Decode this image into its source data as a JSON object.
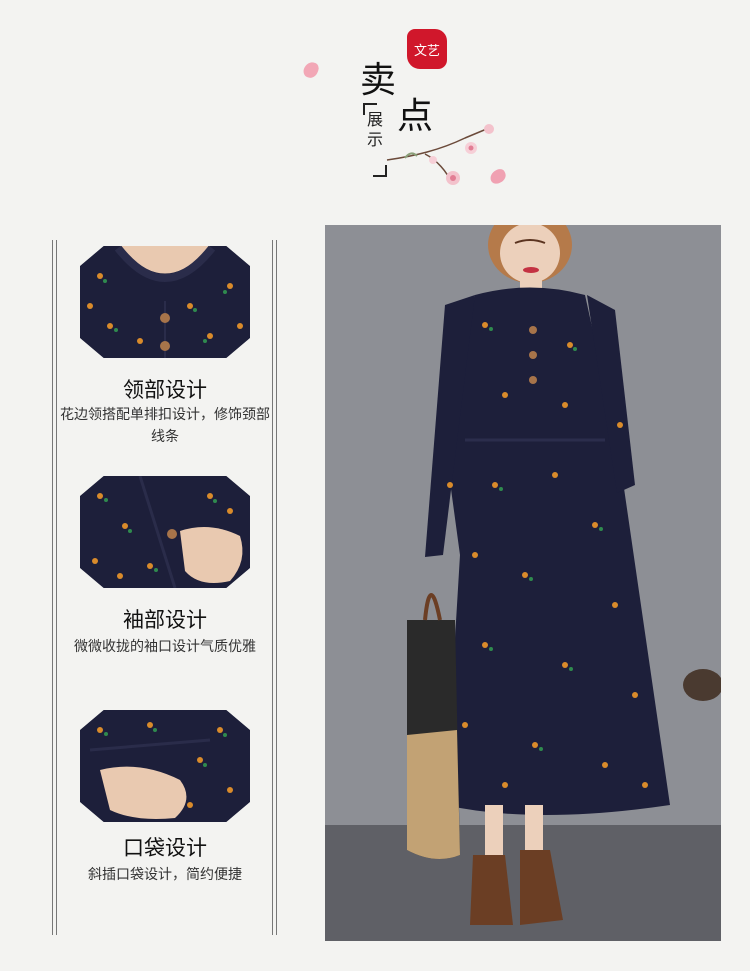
{
  "header": {
    "seal_text": "文艺",
    "title_char_1": "卖",
    "title_char_2": "点",
    "subtitle": "展示"
  },
  "features": [
    {
      "title": "领部设计",
      "desc": "花边领搭配单排扣设计，修饰颈部线条",
      "image_icon": "collar-closeup"
    },
    {
      "title": "袖部设计",
      "desc": "微微收拢的袖口设计气质优雅",
      "image_icon": "cuff-closeup"
    },
    {
      "title": "口袋设计",
      "desc": "斜插口袋设计，简约便捷",
      "image_icon": "pocket-closeup"
    }
  ],
  "colors": {
    "background": "#f3f3f1",
    "seal_red": "#d0172b",
    "dress_navy": "#1d1f3a",
    "petal_pink": "#f2a7b6"
  },
  "main_photo": {
    "icon": "model-in-floral-dress"
  }
}
